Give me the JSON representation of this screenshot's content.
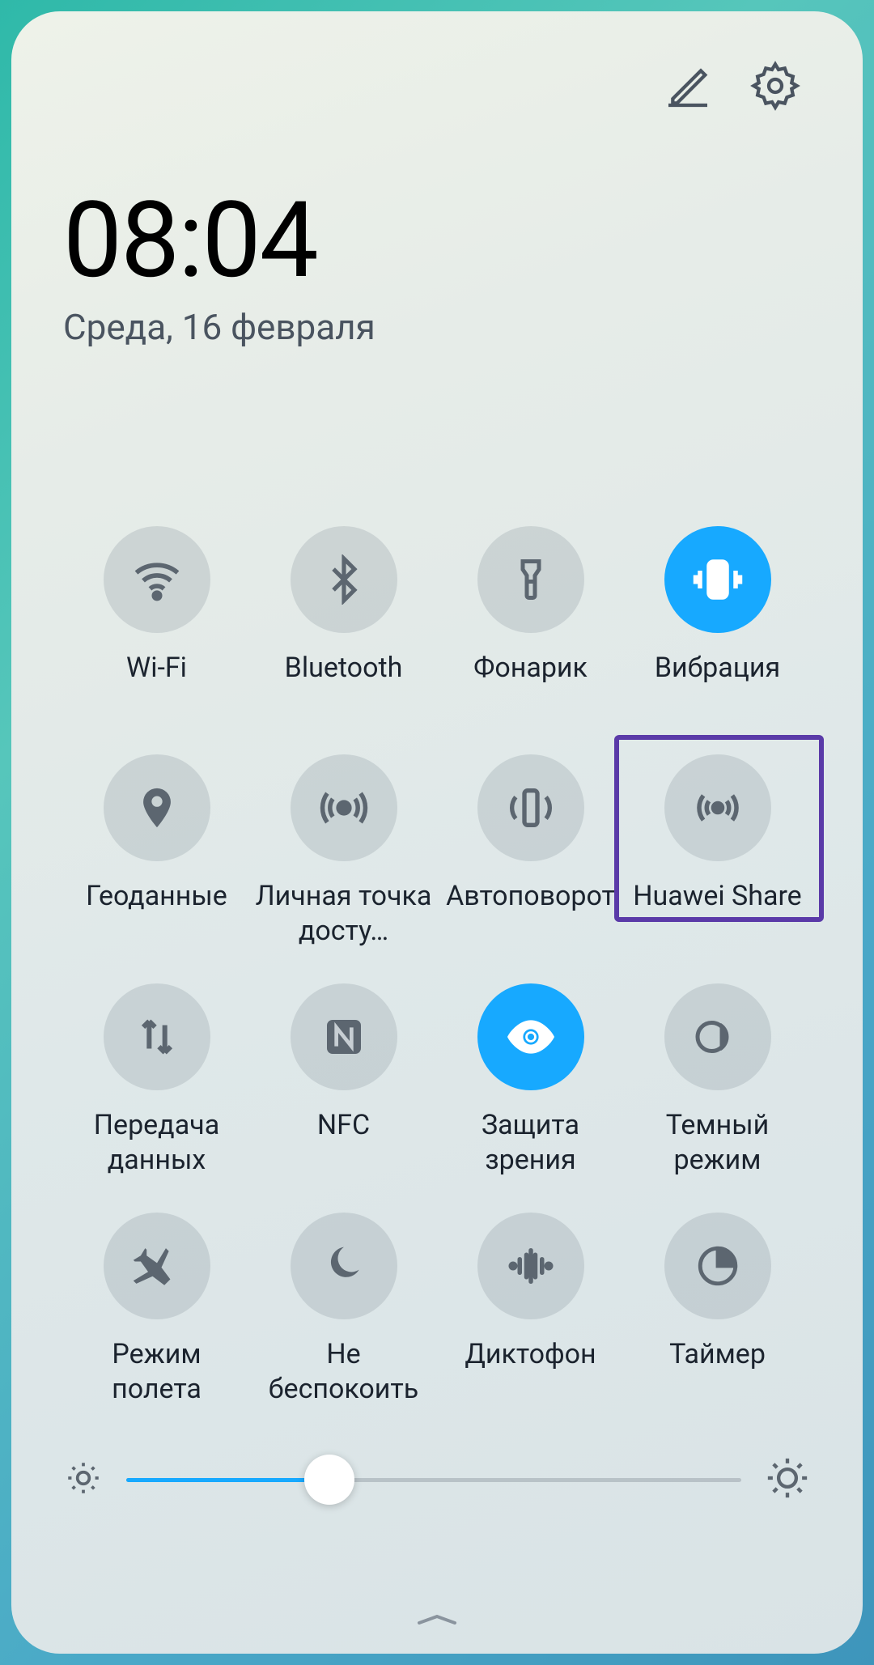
{
  "clock": "08:04",
  "date": "Среда, 16 февраля",
  "tiles": [
    {
      "id": "wifi",
      "label": "Wi-Fi",
      "active": false
    },
    {
      "id": "bluetooth",
      "label": "Bluetooth",
      "active": false
    },
    {
      "id": "flashlight",
      "label": "Фонарик",
      "active": false
    },
    {
      "id": "vibration",
      "label": "Вибрация",
      "active": true
    },
    {
      "id": "location",
      "label": "Геоданные",
      "active": false
    },
    {
      "id": "hotspot",
      "label": "Личная точка досту…",
      "active": false
    },
    {
      "id": "autorotate",
      "label": "Автоповорот",
      "active": false
    },
    {
      "id": "huawei-share",
      "label": "Huawei Share",
      "active": false,
      "highlighted": true
    },
    {
      "id": "data",
      "label": "Передача данных",
      "active": false
    },
    {
      "id": "nfc",
      "label": "NFC",
      "active": false
    },
    {
      "id": "eye-comfort",
      "label": "Защита зрения",
      "active": true
    },
    {
      "id": "dark-mode",
      "label": "Темный режим",
      "active": false
    },
    {
      "id": "airplane",
      "label": "Режим полета",
      "active": false
    },
    {
      "id": "dnd",
      "label": "Не беспокоить",
      "active": false
    },
    {
      "id": "recorder",
      "label": "Диктофон",
      "active": false
    },
    {
      "id": "timer",
      "label": "Таймер",
      "active": false
    }
  ],
  "brightness_percent": 33,
  "highlight_color": "#5a3aa8",
  "accent_color": "#17a9ff"
}
